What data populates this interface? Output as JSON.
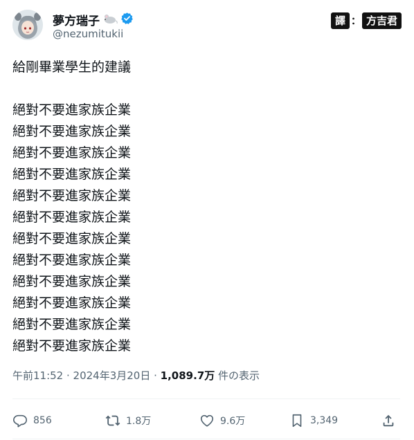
{
  "post": {
    "author": {
      "display_name": "夢方瑞子",
      "handle": "@nezumitukii",
      "verified": true,
      "avatar": "anime-girl-avatar"
    },
    "watermark": [
      "譯",
      "：",
      "方吉君"
    ],
    "title_line": "給剛畢業學生的建議",
    "lines": [
      "絕對不要進家族企業",
      "絕對不要進家族企業",
      "絕對不要進家族企業",
      "絕對不要進家族企業",
      "絕對不要進家族企業",
      "絕對不要進家族企業",
      "絕對不要進家族企業",
      "絕對不要進家族企業",
      "絕對不要進家族企業",
      "絕對不要進家族企業",
      "絕對不要進家族企業",
      "絕對不要進家族企業"
    ],
    "meta": {
      "time": "午前11:52",
      "sep1": " · ",
      "date": "2024年3月20日",
      "sep2": " · ",
      "views": "1,089.7万",
      "views_suffix": " 件の表示"
    },
    "actions": {
      "replies": "856",
      "reposts": "1.8万",
      "likes": "9.6万",
      "bookmarks": "3,349"
    }
  },
  "colors": {
    "text": "#0f1419",
    "secondary": "#536471",
    "verified": "#1d9bf0",
    "divider": "#eff3f4"
  }
}
